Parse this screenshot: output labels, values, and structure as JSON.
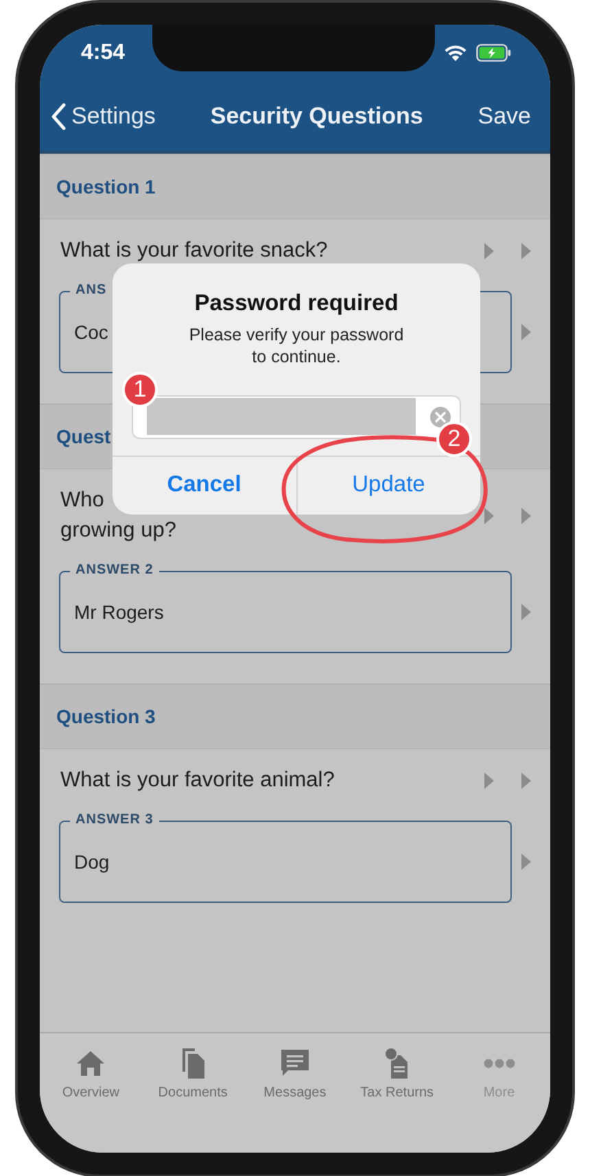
{
  "status_bar": {
    "time": "4:54"
  },
  "nav": {
    "back": "Settings",
    "title": "Security Questions",
    "action": "Save"
  },
  "sections": [
    {
      "heading": "Question 1",
      "question_lines": [
        "What is your favorite snack?"
      ],
      "answer_label": "ANS",
      "answer": "Coc"
    },
    {
      "heading": "Quest",
      "question_lines": [
        "Who",
        "growing up?"
      ],
      "answer_label": "ANSWER 2",
      "answer": "Mr Rogers"
    },
    {
      "heading": "Question 3",
      "question_lines": [
        "What is your favorite animal?"
      ],
      "answer_label": "ANSWER 3",
      "answer": "Dog"
    }
  ],
  "dialog": {
    "title": "Password required",
    "message": "Please verify your password\nto continue.",
    "buttons": [
      {
        "label": "Cancel",
        "kind": "cancel"
      },
      {
        "label": "Update",
        "kind": "default"
      }
    ]
  },
  "annotations": [
    {
      "label": "1"
    },
    {
      "label": "2"
    }
  ],
  "tabs": [
    {
      "label": "Overview",
      "kind": "home",
      "selected": false
    },
    {
      "label": "Documents",
      "kind": "documents",
      "selected": false
    },
    {
      "label": "Messages",
      "kind": "messages",
      "selected": false
    },
    {
      "label": "Tax Returns",
      "kind": "tax",
      "selected": false
    },
    {
      "label": "More",
      "kind": "more",
      "selected": false
    }
  ]
}
